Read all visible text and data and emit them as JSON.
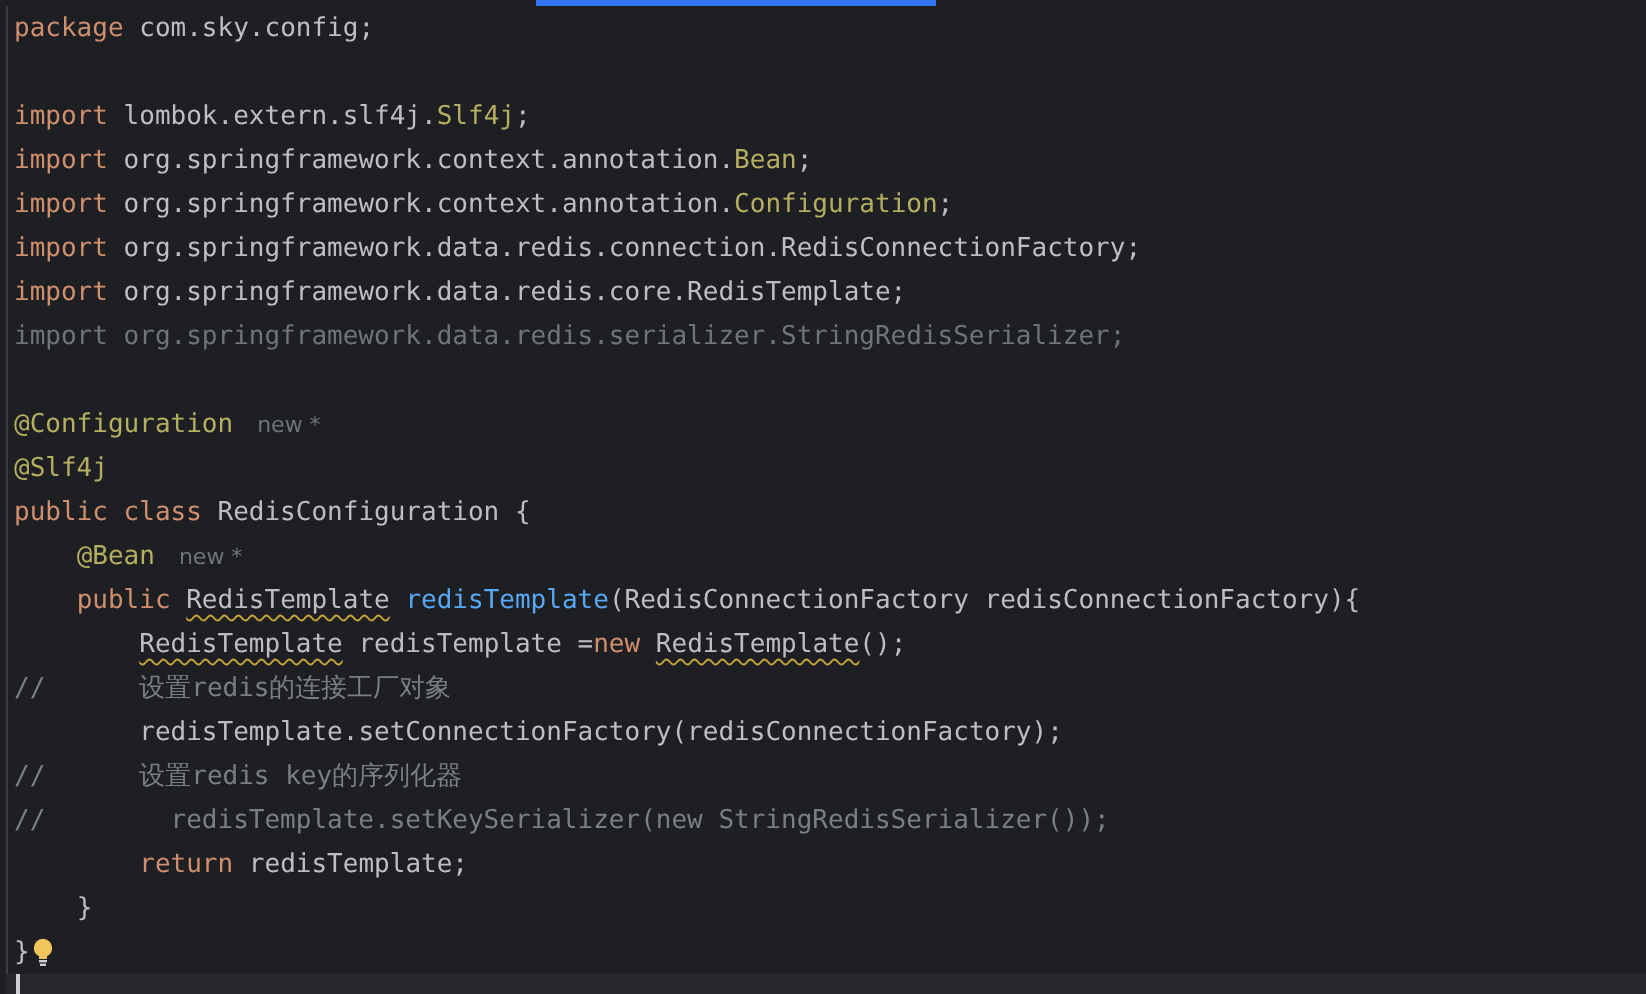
{
  "editor": {
    "lines": [
      {
        "kind": "code",
        "tokens": [
          {
            "kind": "keyword",
            "text": "package"
          },
          {
            "kind": "plain",
            "text": " com.sky.config;"
          }
        ]
      },
      {
        "kind": "blank"
      },
      {
        "kind": "code",
        "tokens": [
          {
            "kind": "keyword",
            "text": "import"
          },
          {
            "kind": "plain",
            "text": " lombok.extern.slf4j."
          },
          {
            "kind": "annotation",
            "text": "Slf4j"
          },
          {
            "kind": "plain",
            "text": ";"
          }
        ]
      },
      {
        "kind": "code",
        "tokens": [
          {
            "kind": "keyword",
            "text": "import"
          },
          {
            "kind": "plain",
            "text": " org.springframework.context.annotation."
          },
          {
            "kind": "annotation",
            "text": "Bean"
          },
          {
            "kind": "plain",
            "text": ";"
          }
        ]
      },
      {
        "kind": "code",
        "tokens": [
          {
            "kind": "keyword",
            "text": "import"
          },
          {
            "kind": "plain",
            "text": " org.springframework.context.annotation."
          },
          {
            "kind": "annotation",
            "text": "Configuration"
          },
          {
            "kind": "plain",
            "text": ";"
          }
        ]
      },
      {
        "kind": "code",
        "tokens": [
          {
            "kind": "keyword",
            "text": "import"
          },
          {
            "kind": "plain",
            "text": " org.springframework.data.redis.connection.RedisConnectionFactory;"
          }
        ]
      },
      {
        "kind": "code",
        "tokens": [
          {
            "kind": "keyword",
            "text": "import"
          },
          {
            "kind": "plain",
            "text": " org.springframework.data.redis.core.RedisTemplate;"
          }
        ]
      },
      {
        "kind": "code",
        "tokens": [
          {
            "kind": "unused",
            "text": "import org.springframework.data.redis.serializer.StringRedisSerializer;"
          }
        ]
      },
      {
        "kind": "blank"
      },
      {
        "kind": "code",
        "tokens": [
          {
            "kind": "annotation",
            "text": "@Configuration"
          }
        ],
        "hint": "new *"
      },
      {
        "kind": "code",
        "tokens": [
          {
            "kind": "annotation",
            "text": "@Slf4j"
          }
        ]
      },
      {
        "kind": "code",
        "tokens": [
          {
            "kind": "keyword",
            "text": "public class"
          },
          {
            "kind": "plain",
            "text": " RedisConfiguration {"
          }
        ]
      },
      {
        "kind": "code",
        "tokens": [
          {
            "kind": "annotation",
            "text": "    @Bean"
          }
        ],
        "hint": "new *"
      },
      {
        "kind": "code",
        "tokens": [
          {
            "kind": "keyword",
            "text": "    public "
          },
          {
            "kind": "warning",
            "text": "RedisTemplate "
          },
          {
            "kind": "method",
            "text": "redisTemplate"
          },
          {
            "kind": "plain",
            "text": "(RedisConnectionFactory redisConnectionFactory){"
          }
        ]
      },
      {
        "kind": "code",
        "tokens": [
          {
            "kind": "warning",
            "text": "        RedisTemplate"
          },
          {
            "kind": "plain",
            "text": " redisTemplate ="
          },
          {
            "kind": "keyword",
            "text": "new "
          },
          {
            "kind": "warning",
            "text": "RedisTemplate"
          },
          {
            "kind": "plain",
            "text": "();"
          }
        ]
      },
      {
        "kind": "code",
        "tokens": [
          {
            "kind": "comment",
            "text": "//      设置redis的连接工厂对象"
          }
        ]
      },
      {
        "kind": "code",
        "tokens": [
          {
            "kind": "plain",
            "text": "        redisTemplate.setConnectionFactory(redisConnectionFactory);"
          }
        ]
      },
      {
        "kind": "code",
        "tokens": [
          {
            "kind": "comment",
            "text": "//      设置redis key的序列化器"
          }
        ]
      },
      {
        "kind": "code",
        "tokens": [
          {
            "kind": "comment",
            "text": "//        redisTemplate.setKeySerializer(new StringRedisSerializer());"
          }
        ]
      },
      {
        "kind": "code",
        "tokens": [
          {
            "kind": "keyword",
            "text": "        return"
          },
          {
            "kind": "plain",
            "text": " redisTemplate;"
          }
        ]
      },
      {
        "kind": "code",
        "tokens": [
          {
            "kind": "plain",
            "text": "    }"
          }
        ]
      },
      {
        "kind": "code",
        "tokens": [
          {
            "kind": "plain",
            "text": "}"
          }
        ],
        "intention_bulb": true
      },
      {
        "kind": "blank",
        "caret": true
      }
    ]
  }
}
